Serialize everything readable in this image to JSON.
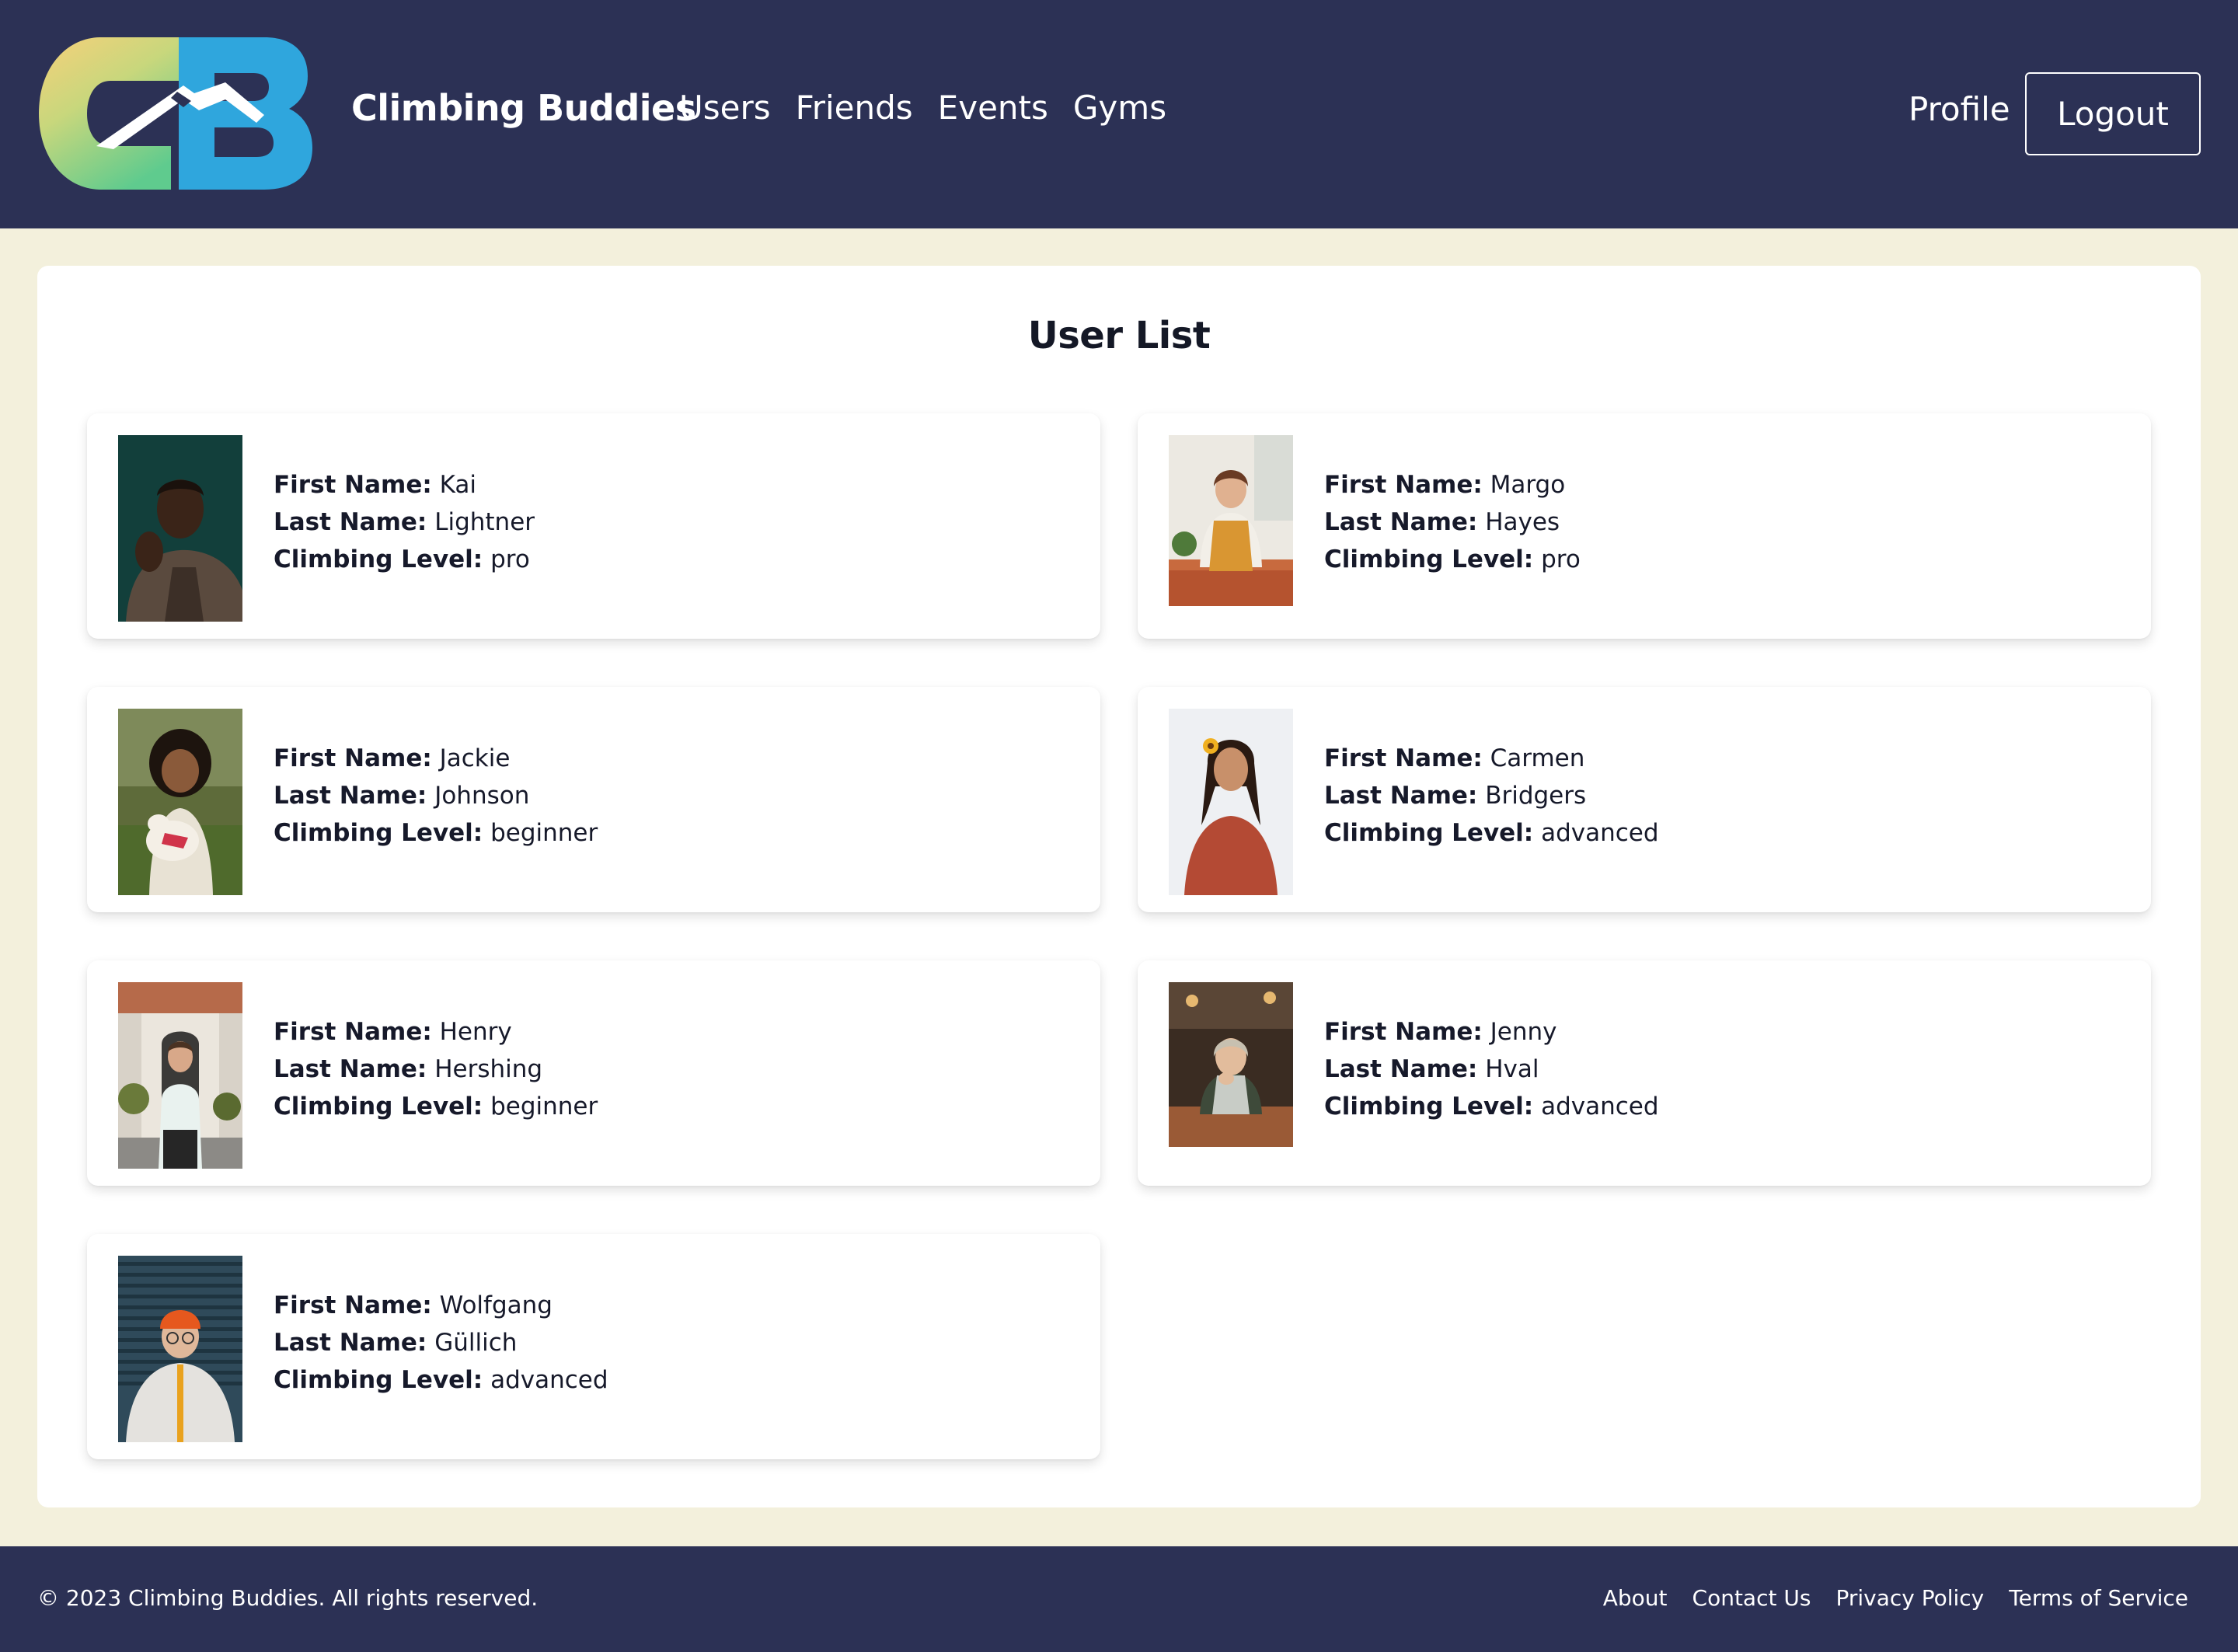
{
  "brand": {
    "name": "Climbing Buddies",
    "logo_letters": "CB"
  },
  "nav": {
    "links": [
      "Users",
      "Friends",
      "Events",
      "Gyms"
    ],
    "profile": "Profile",
    "logout": "Logout"
  },
  "page": {
    "title": "User List"
  },
  "labels": {
    "first_name": "First Name:",
    "last_name": "Last Name:",
    "climbing_level": "Climbing Level:"
  },
  "users": [
    {
      "first_name": "Kai",
      "last_name": "Lightner",
      "climbing_level": "pro"
    },
    {
      "first_name": "Margo",
      "last_name": "Hayes",
      "climbing_level": "pro"
    },
    {
      "first_name": "Jackie",
      "last_name": "Johnson",
      "climbing_level": "beginner"
    },
    {
      "first_name": "Carmen",
      "last_name": "Bridgers",
      "climbing_level": "advanced"
    },
    {
      "first_name": "Henry",
      "last_name": "Hershing",
      "climbing_level": "beginner"
    },
    {
      "first_name": "Jenny",
      "last_name": "Hval",
      "climbing_level": "advanced"
    },
    {
      "first_name": "Wolfgang",
      "last_name": "Güllich",
      "climbing_level": "advanced"
    }
  ],
  "footer": {
    "copyright": "© 2023 Climbing Buddies. All rights reserved.",
    "links": [
      "About",
      "Contact Us",
      "Privacy Policy",
      "Terms of Service"
    ]
  },
  "colors": {
    "nav_bg": "#2c3155",
    "page_bg": "#f3f0dc",
    "panel_bg": "#ffffff",
    "logo_yellow": "#f5d27a",
    "logo_green": "#6fcf8f",
    "logo_blue": "#2fa6dd"
  }
}
